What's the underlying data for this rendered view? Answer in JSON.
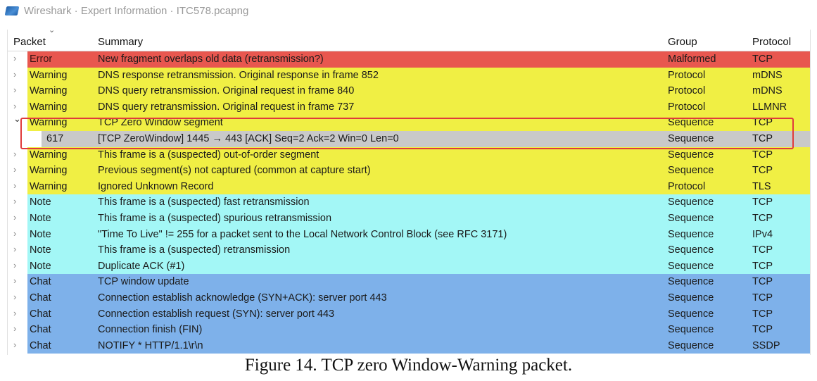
{
  "window": {
    "title": "Wireshark · Expert Information · ITC578.pcapng"
  },
  "columns": {
    "packet": "Packet",
    "summary": "Summary",
    "group": "Group",
    "protocol": "Protocol"
  },
  "colors": {
    "Error": "#e8574f",
    "Warning": "#f0ef44",
    "Note": "#a3f7f6",
    "Chat": "#7eb1ea",
    "Selected": "#c9c9c9",
    "highlight_box": "#e03b3b"
  },
  "rows": [
    {
      "severity": "Error",
      "summary": "New fragment overlaps old data (retransmission?)",
      "group": "Malformed",
      "protocol": "TCP",
      "expanded": false
    },
    {
      "severity": "Warning",
      "summary": "DNS response retransmission. Original response in frame 852",
      "group": "Protocol",
      "protocol": "mDNS",
      "expanded": false
    },
    {
      "severity": "Warning",
      "summary": "DNS query retransmission. Original request in frame 840",
      "group": "Protocol",
      "protocol": "mDNS",
      "expanded": false
    },
    {
      "severity": "Warning",
      "summary": "DNS query retransmission. Original request in frame 737",
      "group": "Protocol",
      "protocol": "LLMNR",
      "expanded": false
    },
    {
      "severity": "Warning",
      "summary": "TCP Zero Window segment",
      "group": "Sequence",
      "protocol": "TCP",
      "expanded": true
    },
    {
      "packet": "617",
      "summary": "[TCP ZeroWindow] 1445 → 443 [ACK] Seq=2 Ack=2 Win=0 Len=0",
      "group": "Sequence",
      "protocol": "TCP",
      "child": true
    },
    {
      "severity": "Warning",
      "summary": "This frame is a (suspected) out-of-order segment",
      "group": "Sequence",
      "protocol": "TCP",
      "expanded": false
    },
    {
      "severity": "Warning",
      "summary": "Previous segment(s) not captured (common at capture start)",
      "group": "Sequence",
      "protocol": "TCP",
      "expanded": false
    },
    {
      "severity": "Warning",
      "summary": "Ignored Unknown Record",
      "group": "Protocol",
      "protocol": "TLS",
      "expanded": false
    },
    {
      "severity": "Note",
      "summary": "This frame is a (suspected) fast retransmission",
      "group": "Sequence",
      "protocol": "TCP",
      "expanded": false
    },
    {
      "severity": "Note",
      "summary": "This frame is a (suspected) spurious retransmission",
      "group": "Sequence",
      "protocol": "TCP",
      "expanded": false
    },
    {
      "severity": "Note",
      "summary": "\"Time To Live\" != 255 for a packet sent to the Local Network Control Block (see RFC 3171)",
      "group": "Sequence",
      "protocol": "IPv4",
      "expanded": false
    },
    {
      "severity": "Note",
      "summary": "This frame is a (suspected) retransmission",
      "group": "Sequence",
      "protocol": "TCP",
      "expanded": false
    },
    {
      "severity": "Note",
      "summary": "Duplicate ACK (#1)",
      "group": "Sequence",
      "protocol": "TCP",
      "expanded": false
    },
    {
      "severity": "Chat",
      "summary": "TCP window update",
      "group": "Sequence",
      "protocol": "TCP",
      "expanded": false
    },
    {
      "severity": "Chat",
      "summary": "Connection establish acknowledge (SYN+ACK): server port 443",
      "group": "Sequence",
      "protocol": "TCP",
      "expanded": false
    },
    {
      "severity": "Chat",
      "summary": "Connection establish request (SYN): server port 443",
      "group": "Sequence",
      "protocol": "TCP",
      "expanded": false
    },
    {
      "severity": "Chat",
      "summary": "Connection finish (FIN)",
      "group": "Sequence",
      "protocol": "TCP",
      "expanded": false
    },
    {
      "severity": "Chat",
      "summary": "NOTIFY * HTTP/1.1\\r\\n",
      "group": "Sequence",
      "protocol": "SSDP",
      "expanded": false
    }
  ],
  "caption": "Figure 14. TCP zero Window-Warning packet."
}
